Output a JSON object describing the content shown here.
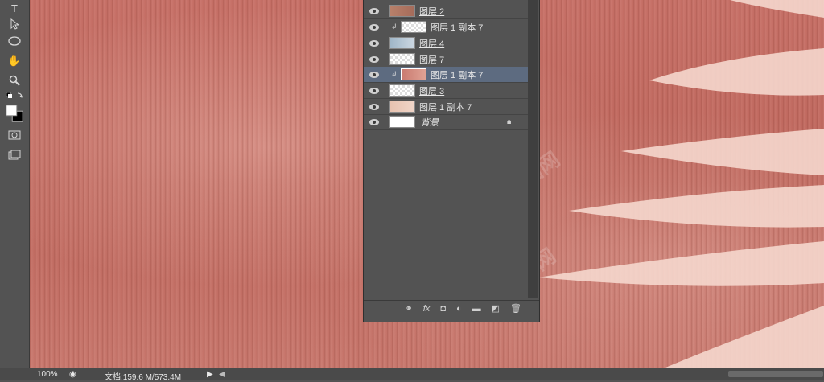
{
  "toolbar": {
    "tools": [
      "type-tool",
      "path-select-tool",
      "ellipse-tool",
      "hand-tool",
      "zoom-tool",
      "default-colors",
      "foreground-background",
      "quick-mask",
      "screen-mode"
    ]
  },
  "layers": [
    {
      "name": "图层 2",
      "clipped": false,
      "selected": false,
      "locked": false
    },
    {
      "name": "图层 1 副本 7",
      "clipped": true,
      "selected": false,
      "locked": false
    },
    {
      "name": "图层 4",
      "clipped": false,
      "selected": false,
      "locked": false
    },
    {
      "name": "图层 7",
      "clipped": false,
      "selected": false,
      "locked": false
    },
    {
      "name": "图层 1 副本 7",
      "clipped": true,
      "selected": true,
      "locked": false
    },
    {
      "name": "图层 3",
      "clipped": false,
      "selected": false,
      "locked": false
    },
    {
      "name": "图层 1 副本 7",
      "clipped": false,
      "selected": false,
      "locked": false
    },
    {
      "name": "背景",
      "clipped": false,
      "selected": false,
      "locked": true
    }
  ],
  "panel_footer": {
    "icons": [
      "link-icon",
      "fx-icon",
      "mask-icon",
      "adjustment-icon",
      "folder-icon",
      "new-layer-icon",
      "trash-icon"
    ],
    "fx_label": "fx"
  },
  "status": {
    "zoom": "100%",
    "doc_label": "文档:159.6 M/573.4M"
  },
  "colors": {
    "canvas": "#c06a60",
    "panel": "#535353",
    "selected_row": "#5d6b80"
  }
}
